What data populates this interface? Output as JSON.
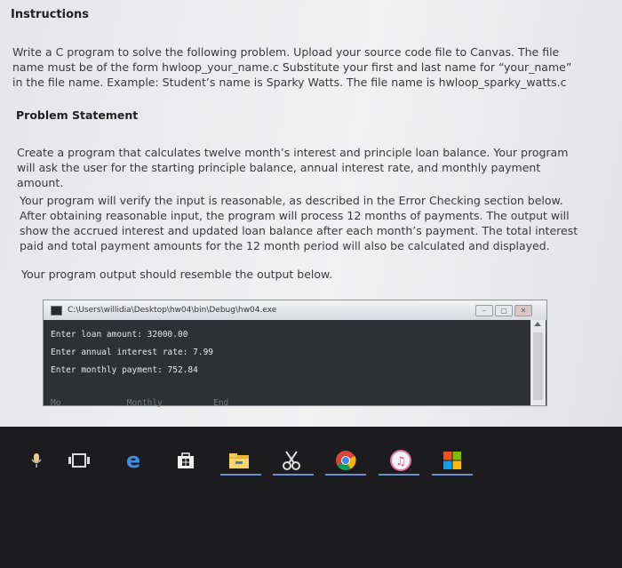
{
  "instructions": {
    "heading": "Instructions",
    "para1": "Write a C program to solve the following problem. Upload your source code file to Canvas. The file name must be of the form hwloop_your_name.c Substitute your first and last name for “your_name” in the file name. Example: Student’s name is Sparky Watts. The file name is hwloop_sparky_watts.c"
  },
  "problem": {
    "heading": "Problem Statement",
    "para1": "Create a program that calculates twelve month’s interest and principle loan balance. Your program will ask the user for the starting principle balance, annual interest rate, and monthly payment amount.",
    "para2": "Your program will verify the input is reasonable, as described in the Error Checking section below. After obtaining reasonable input, the program will process 12 months of payments. The output will show the accrued interest and updated loan balance after each month’s payment. The total interest paid and total payment amounts for the 12 month period will also be calculated and displayed.",
    "para3": "Your program output should resemble the output below."
  },
  "console": {
    "title": "C:\\Users\\willidia\\Desktop\\hw04\\bin\\Debug\\hw04.exe",
    "lines": [
      "Enter loan amount: 32000.00",
      "Enter annual interest rate: 7.99",
      "Enter monthly payment: 752.84"
    ],
    "partial_line": "Mo             Monthly          End"
  },
  "taskbar": {
    "icons": [
      "microphone-icon",
      "task-view-icon",
      "edge-browser-icon",
      "store-icon",
      "file-explorer-icon",
      "snipping-tool-icon",
      "chrome-icon",
      "itunes-icon",
      "office-icon"
    ]
  },
  "colors": {
    "text": "#3a3a3c",
    "console_bg": "#2f3033",
    "taskbar_bg": "#1c1c1f",
    "active_underline": "#6a8fd0"
  }
}
